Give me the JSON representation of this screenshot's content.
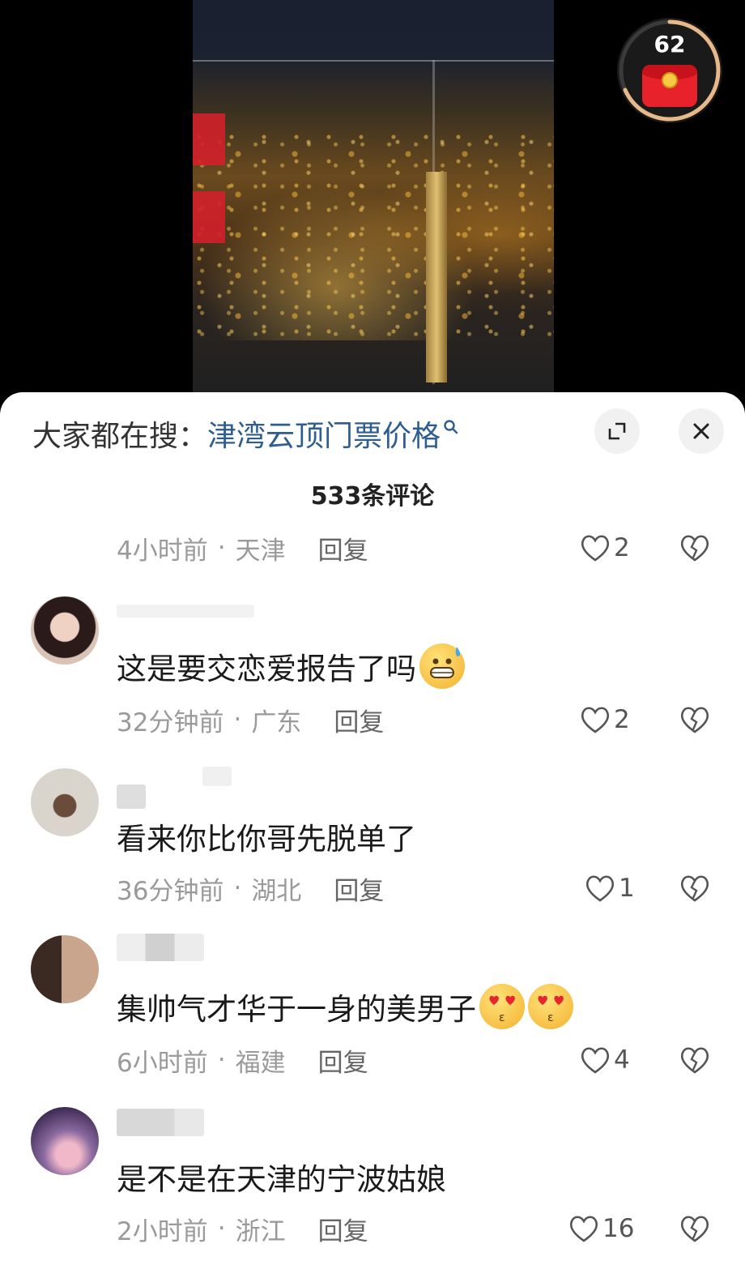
{
  "red_packet": {
    "count": "62"
  },
  "sheet": {
    "search_prefix": "大家都在搜：",
    "search_term": "津湾云顶门票价格",
    "comment_count": "533条评论"
  },
  "first_meta": {
    "time": "4小时前",
    "location": "天津",
    "reply": "回复",
    "likes": "2"
  },
  "comments": [
    {
      "text": "这是要交恋爱报告了吗",
      "emoji": "sweat-grin-emoji",
      "time": "32分钟前",
      "location": "广东",
      "reply": "回复",
      "likes": "2"
    },
    {
      "text": "看来你比你哥先脱单了",
      "time": "36分钟前",
      "location": "湖北",
      "reply": "回复",
      "likes": "1"
    },
    {
      "text": "集帅气才华于一身的美男子",
      "emoji": "kissing-heart-eyes-emoji",
      "time": "6小时前",
      "location": "福建",
      "reply": "回复",
      "likes": "4"
    },
    {
      "text": "是不是在天津的宁波姑娘",
      "time": "2小时前",
      "location": "浙江",
      "reply": "回复",
      "likes": "16"
    }
  ],
  "colors": {
    "search_term": "#2d5d91",
    "red_packet": "#e8222a",
    "meta": "#9a9a9a"
  }
}
